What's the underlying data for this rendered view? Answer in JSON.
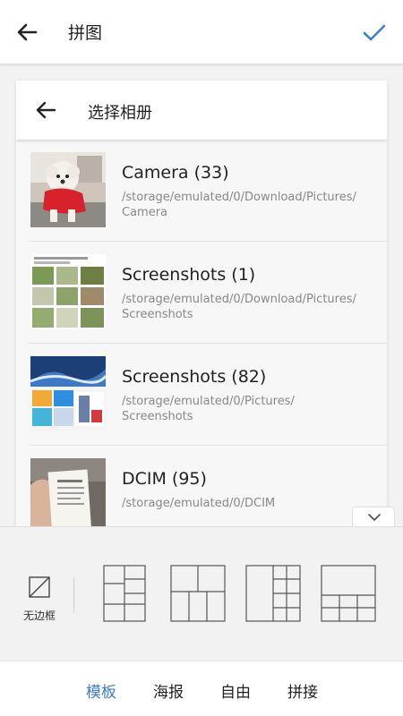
{
  "topbar": {
    "title": "拼图"
  },
  "album_picker": {
    "title": "选择相册",
    "albums": [
      {
        "name": "Camera (33)",
        "path": "/storage/emulated/0/Download/Pictures/\nCamera"
      },
      {
        "name": "Screenshots (1)",
        "path": "/storage/emulated/0/Download/Pictures/\nScreenshots"
      },
      {
        "name": "Screenshots (82)",
        "path": "/storage/emulated/0/Pictures/\nScreenshots"
      },
      {
        "name": "DCIM (95)",
        "path": "/storage/emulated/0/DCIM"
      }
    ]
  },
  "templates": {
    "no_border_label": "无边框"
  },
  "bottom_tabs": [
    "模板",
    "海报",
    "自由",
    "拼接"
  ],
  "colors": {
    "accent": "#3a7bd5",
    "text": "#222222",
    "muted": "#888888"
  }
}
